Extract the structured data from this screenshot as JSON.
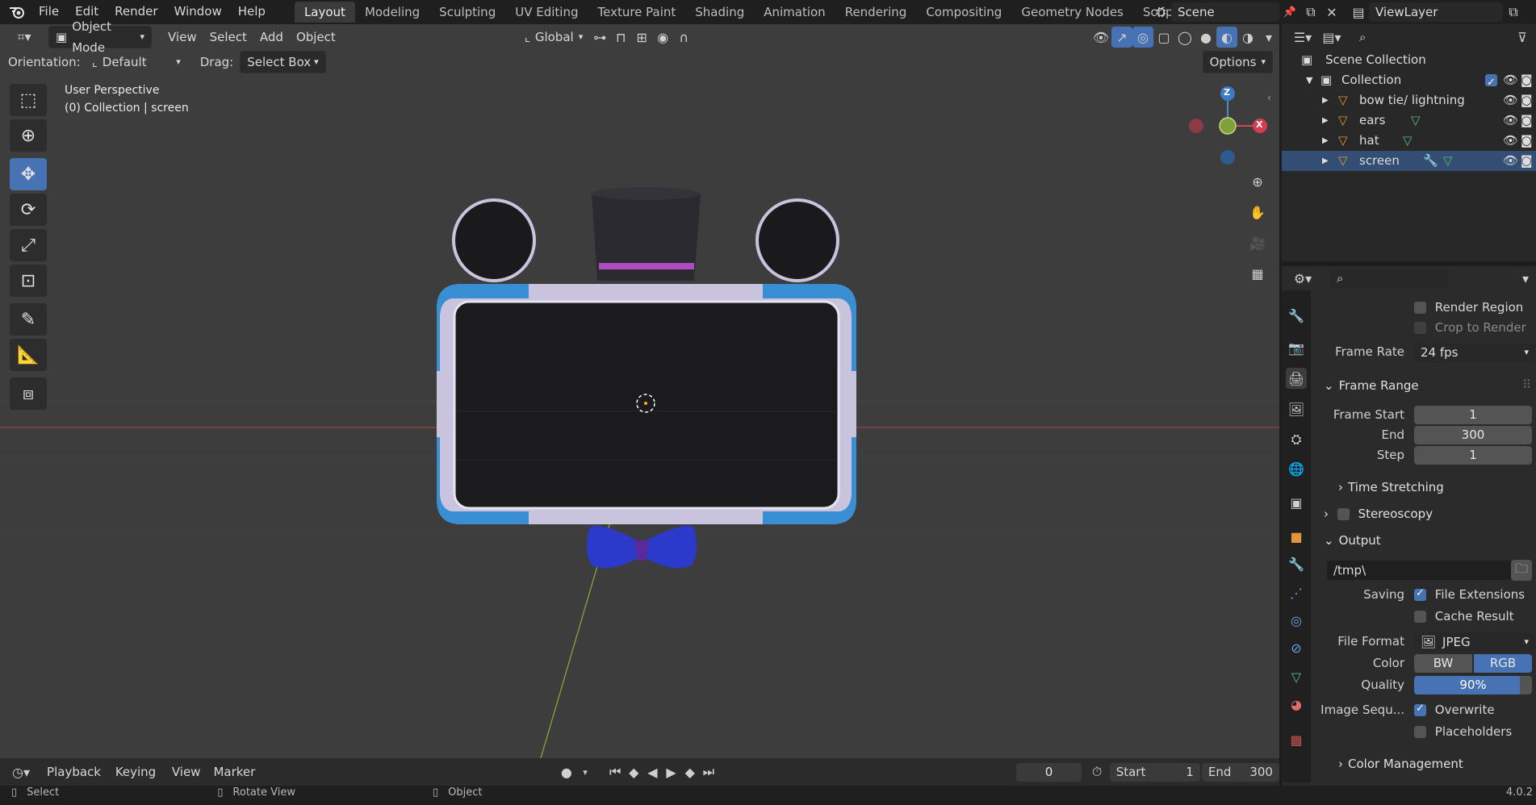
{
  "menu": {
    "items": [
      "File",
      "Edit",
      "Render",
      "Window",
      "Help"
    ]
  },
  "workspaces": {
    "tabs": [
      "Layout",
      "Modeling",
      "Sculpting",
      "UV Editing",
      "Texture Paint",
      "Shading",
      "Animation",
      "Rendering",
      "Compositing",
      "Geometry Nodes",
      "Scripting"
    ],
    "active": "Layout",
    "add_symbol": "+"
  },
  "scene": {
    "name": "Scene",
    "view_layer": "ViewLayer"
  },
  "viewport_header": {
    "mode": "Object Mode",
    "menus": [
      "View",
      "Select",
      "Add",
      "Object"
    ],
    "transform_orientation": "Global",
    "options_label": "Options"
  },
  "tool_settings": {
    "orientation_label": "Orientation:",
    "orientation_value": "Default",
    "drag_label": "Drag:",
    "drag_value": "Select Box"
  },
  "viewport_info": {
    "line1": "User Perspective",
    "line2": "(0) Collection | screen"
  },
  "gizmo": {
    "z": "Z",
    "x": "X"
  },
  "outliner": {
    "root": "Scene Collection",
    "collection": "Collection",
    "objects": [
      "bow tie/ lightning",
      "ears",
      "hat",
      "screen"
    ]
  },
  "properties": {
    "render_region": "Render Region",
    "crop_to_render": "Crop to Render ...",
    "frame_rate_label": "Frame Rate",
    "frame_rate_value": "24 fps",
    "frame_range_title": "Frame Range",
    "frame_start_label": "Frame Start",
    "frame_start": "1",
    "end_label": "End",
    "end": "300",
    "step_label": "Step",
    "step": "1",
    "time_stretching": "Time Stretching",
    "stereoscopy": "Stereoscopy",
    "output_title": "Output",
    "output_path": "/tmp\\",
    "saving_label": "Saving",
    "file_extensions": "File Extensions",
    "cache_result": "Cache Result",
    "file_format_label": "File Format",
    "file_format_value": "JPEG",
    "color_label": "Color",
    "color_bw": "BW",
    "color_rgb": "RGB",
    "quality_label": "Quality",
    "quality_value": "90%",
    "quality_fraction": 0.9,
    "image_sequence_label": "Image Sequ...",
    "overwrite": "Overwrite",
    "placeholders": "Placeholders",
    "color_management": "Color Management"
  },
  "timeline": {
    "menus": [
      "Playback",
      "Keying",
      "View",
      "Marker"
    ],
    "current_frame": "0",
    "start_label": "Start",
    "start": "1",
    "end_label": "End",
    "end": "300"
  },
  "statusbar": {
    "items": [
      "Select",
      "Rotate View",
      "Object"
    ],
    "version": "4.0.2"
  },
  "colors": {
    "accent": "#4772b3",
    "viewport_bg": "#3d3d3d",
    "frame_blue": "#3a8fd4",
    "bow_blue": "#2b3acb",
    "hat_band": "#b04bc0"
  }
}
